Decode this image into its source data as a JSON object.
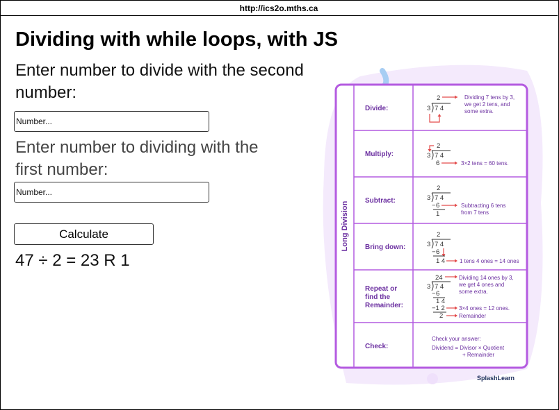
{
  "browser": {
    "url": "http://ics2o.mths.ca"
  },
  "page": {
    "title": "Dividing with while loops, with JS",
    "prompt1_lines": [
      "Enter number to divide with the second",
      "number:"
    ],
    "prompt2_lines": [
      "Enter number to dividing with the",
      "first number:"
    ],
    "input1_placeholder": "Number...",
    "input2_placeholder": "Number...",
    "calculate_label": "Calculate",
    "result": "47 ÷ 2 = 23 R 1"
  },
  "infographic": {
    "vertical_title": "Long Division",
    "brand": "SplashLearn",
    "accent_color": "#b45be0",
    "label_color": "#6b2fa0",
    "arrow_color": "#e34b4b",
    "steps": [
      {
        "label_lines": [
          "Divide:"
        ],
        "notes": [
          "Dividing 7 tens by 3,",
          "we get 2 tens, and",
          "some extra."
        ]
      },
      {
        "label_lines": [
          "Multiply:"
        ],
        "notes": [
          "3×2 tens = 60 tens."
        ]
      },
      {
        "label_lines": [
          "Subtract:"
        ],
        "notes": [
          "Subtracting 6 tens",
          "from 7 tens"
        ]
      },
      {
        "label_lines": [
          "Bring down:"
        ],
        "notes": [
          "1 tens 4 ones = 14 ones"
        ]
      },
      {
        "label_lines": [
          "Repeat or",
          "find the",
          "Remainder:"
        ],
        "notes": [
          "Dividing 14 ones by 3,",
          "we get 4 ones and",
          "some extra.",
          "3×4 ones = 12 ones.",
          "Remainder"
        ]
      },
      {
        "label_lines": [
          "Check:"
        ],
        "notes": [
          "Check your answer:",
          "Dividend = Divisor × Quotient",
          "+ Remainder"
        ]
      }
    ],
    "digits": {
      "divisor": "3",
      "dividend": "7 4",
      "q1": "2",
      "q2": "24",
      "m1": "6",
      "d1": "1",
      "b1": "1 4",
      "m2": "1 2",
      "r": "2",
      "ms": "−",
      "ms2": "−1 2"
    }
  }
}
